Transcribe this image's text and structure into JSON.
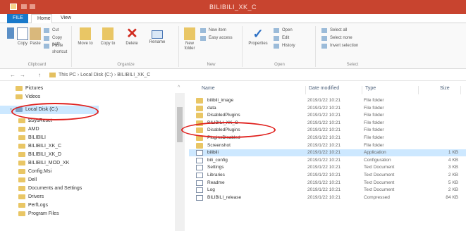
{
  "window": {
    "title": "BILIBILI_XK_C"
  },
  "tabs": [
    {
      "label": "FILE"
    },
    {
      "label": "Home"
    },
    {
      "label": "View"
    }
  ],
  "ribbon": {
    "clipboard": {
      "label": "Clipboard",
      "copy": "Copy",
      "paste": "Paste",
      "cut": "Cut",
      "copy_path": "Copy path",
      "paste_shortcut": "Paste shortcut"
    },
    "organize": {
      "label": "Organize",
      "move_to": "Move to",
      "copy_to": "Copy to",
      "delete": "Delete",
      "rename": "Rename"
    },
    "new": {
      "label": "New",
      "new_folder": "New folder",
      "new_item": "New item",
      "easy_access": "Easy access"
    },
    "open": {
      "label": "Open",
      "properties": "Properties",
      "open": "Open",
      "edit": "Edit",
      "history": "History"
    },
    "select": {
      "label": "Select",
      "select_all": "Select all",
      "select_none": "Select none",
      "invert": "Invert selection"
    }
  },
  "address": {
    "back": "←",
    "forward": "→",
    "up": "↑",
    "path": "This PC › Local Disk (C:) › BILIBILI_XK_C"
  },
  "nav": {
    "items": [
      {
        "label": "Pictures"
      },
      {
        "label": "Videos"
      },
      {
        "label": "Local Disk (C:)"
      },
      {
        "label": "$SysReset"
      },
      {
        "label": "AMD"
      },
      {
        "label": "BILIBILI"
      },
      {
        "label": "BILIBILI_XK_C"
      },
      {
        "label": "BILIBILI_XK_D"
      },
      {
        "label": "BILIBILI_MOD_XK"
      },
      {
        "label": "Config.Msi"
      },
      {
        "label": "Dell"
      },
      {
        "label": "Documents and Settings"
      },
      {
        "label": "Drivers"
      },
      {
        "label": "PerfLogs"
      },
      {
        "label": "Program Files"
      }
    ]
  },
  "columns": {
    "name": "Name",
    "date": "Date modified",
    "type": "Type",
    "size": "Size"
  },
  "files": [
    {
      "name": "bilibili_image",
      "date": "2019/1/22 10:21",
      "type": "File folder",
      "size": "",
      "kind": "folder"
    },
    {
      "name": "data",
      "date": "2019/1/22 10:21",
      "type": "File folder",
      "size": "",
      "kind": "folder"
    },
    {
      "name": "DisabledPlugins",
      "date": "2019/1/22 10:21",
      "type": "File folder",
      "size": "",
      "kind": "folder"
    },
    {
      "name": "BILIBILI_XK_C",
      "date": "2019/1/22 10:21",
      "type": "File folder",
      "size": "",
      "kind": "folder"
    },
    {
      "name": "DisabledPlugins",
      "date": "2019/1/22 10:21",
      "type": "File folder",
      "size": "",
      "kind": "folder"
    },
    {
      "name": "PluginsDisabled",
      "date": "2019/1/22 10:21",
      "type": "File folder",
      "size": "",
      "kind": "folder"
    },
    {
      "name": "Screenshot",
      "date": "2019/1/22 10:21",
      "type": "File folder",
      "size": "",
      "kind": "folder"
    },
    {
      "name": "bilibili",
      "date": "2019/1/22 10:21",
      "type": "Application",
      "size": "1 KB",
      "kind": "file",
      "selected": true
    },
    {
      "name": "bili_config",
      "date": "2019/1/22 10:21",
      "type": "Configuration",
      "size": "4 KB",
      "kind": "file"
    },
    {
      "name": "Settings",
      "date": "2019/1/22 10:21",
      "type": "Text Document",
      "size": "3 KB",
      "kind": "file"
    },
    {
      "name": "Libraries",
      "date": "2019/1/22 10:21",
      "type": "Text Document",
      "size": "2 KB",
      "kind": "file"
    },
    {
      "name": "Readme",
      "date": "2019/1/22 10:21",
      "type": "Text Document",
      "size": "5 KB",
      "kind": "file"
    },
    {
      "name": "Log",
      "date": "2019/1/22 10:21",
      "type": "Text Document",
      "size": "2 KB",
      "kind": "file"
    },
    {
      "name": "BILIBILI_release",
      "date": "2019/1/22 10:21",
      "type": "Compressed",
      "size": "84 KB",
      "kind": "file"
    }
  ],
  "colors": {
    "titlebar": "#c8442f",
    "accent": "#1979ca",
    "selection": "#cce8ff",
    "annotation": "#e0201d"
  }
}
